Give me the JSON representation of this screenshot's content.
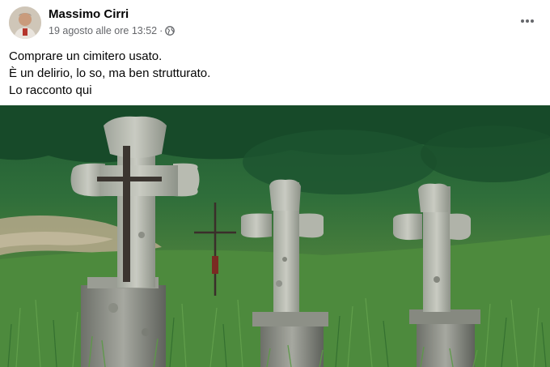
{
  "post": {
    "author": "Massimo Cirri",
    "timestamp": "19 agosto alle ore 13:52",
    "separator": "·",
    "privacy_icon": "globe-icon",
    "menu_icon": "more-options-icon",
    "lines": [
      "Comprare un cimitero usato.",
      "È un delirio, lo so, ma ben strutturato.",
      "Lo racconto qui"
    ],
    "photo": {
      "subject": "Croci di pietra in un prato verde"
    }
  },
  "colors": {
    "text_primary": "#050505",
    "text_secondary": "#65676b",
    "background": "#ffffff"
  }
}
